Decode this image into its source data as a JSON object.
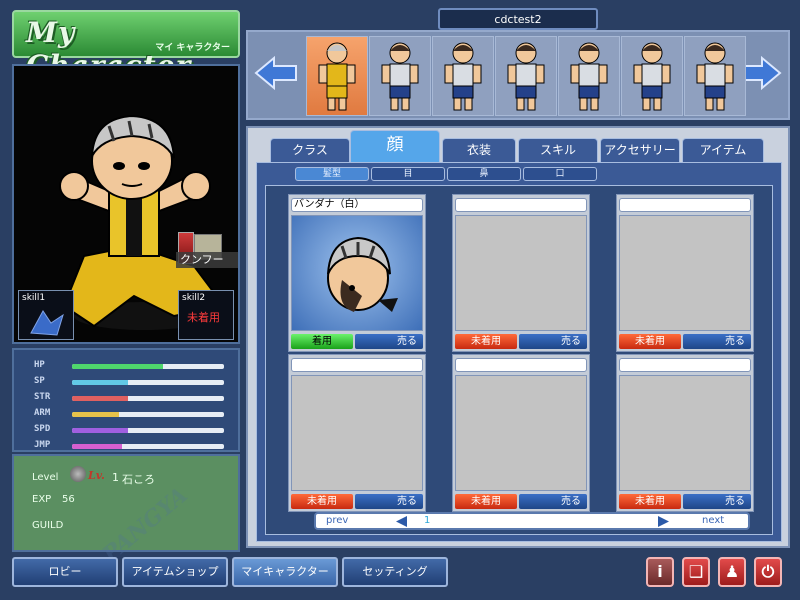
{
  "title": {
    "main": "My Character",
    "sub": "マイ キャラクター"
  },
  "character_name": "cdctest2",
  "skills": {
    "slot1_label": "skill1",
    "slot2_label": "skill2",
    "slot2_status": "未着用",
    "popup_label": "クンフー"
  },
  "stats": [
    {
      "label": "HP",
      "value": 0.6,
      "color": "#4fd66c"
    },
    {
      "label": "SP",
      "value": 0.37,
      "color": "#62c9e6"
    },
    {
      "label": "STR",
      "value": 0.37,
      "color": "#e06060"
    },
    {
      "label": "ARM",
      "value": 0.31,
      "color": "#e7c24a"
    },
    {
      "label": "SPD",
      "value": 0.37,
      "color": "#a05fe0"
    },
    {
      "label": "JMP",
      "value": 0.33,
      "color": "#d65fd0"
    }
  ],
  "info": {
    "level_label": "Level",
    "level_badge": "Lv.",
    "level_value": "1",
    "level_title": "石ころ",
    "exp_label": "EXP",
    "exp_value": "56",
    "guild_label": "GUILD"
  },
  "tabs": [
    {
      "label": "クラス",
      "active": false
    },
    {
      "label": "顔",
      "active": true
    },
    {
      "label": "衣装",
      "active": false
    },
    {
      "label": "スキル",
      "active": false
    },
    {
      "label": "アクセサリー",
      "active": false
    },
    {
      "label": "アイテム",
      "active": false
    }
  ],
  "subtabs": [
    {
      "label": "髪型",
      "active": true
    },
    {
      "label": "目",
      "active": false
    },
    {
      "label": "鼻",
      "active": false
    },
    {
      "label": "口",
      "active": false
    }
  ],
  "items": [
    {
      "name": "バンダナ（白）",
      "status": "着用",
      "equipped": true,
      "sell": "売る"
    },
    {
      "name": "",
      "status": "未着用",
      "equipped": false,
      "sell": "売る"
    },
    {
      "name": "",
      "status": "未着用",
      "equipped": false,
      "sell": "売る"
    },
    {
      "name": "",
      "status": "未着用",
      "equipped": false,
      "sell": "売る"
    },
    {
      "name": "",
      "status": "未着用",
      "equipped": false,
      "sell": "売る"
    },
    {
      "name": "",
      "status": "未着用",
      "equipped": false,
      "sell": "売る"
    }
  ],
  "pager": {
    "prev": "prev",
    "page": "1",
    "next": "next"
  },
  "bottom_nav": [
    {
      "label": "ロビー",
      "active": false
    },
    {
      "label": "アイテムショップ",
      "active": false
    },
    {
      "label": "マイキャラクター",
      "active": true
    },
    {
      "label": "セッティング",
      "active": false
    }
  ],
  "icon_buttons": [
    "info-icon",
    "gift-icon",
    "person-icon",
    "power-icon"
  ],
  "colors": {
    "accent": "#55a6ea",
    "equipped": "#1aa21a",
    "unequipped": "#c82a10"
  }
}
